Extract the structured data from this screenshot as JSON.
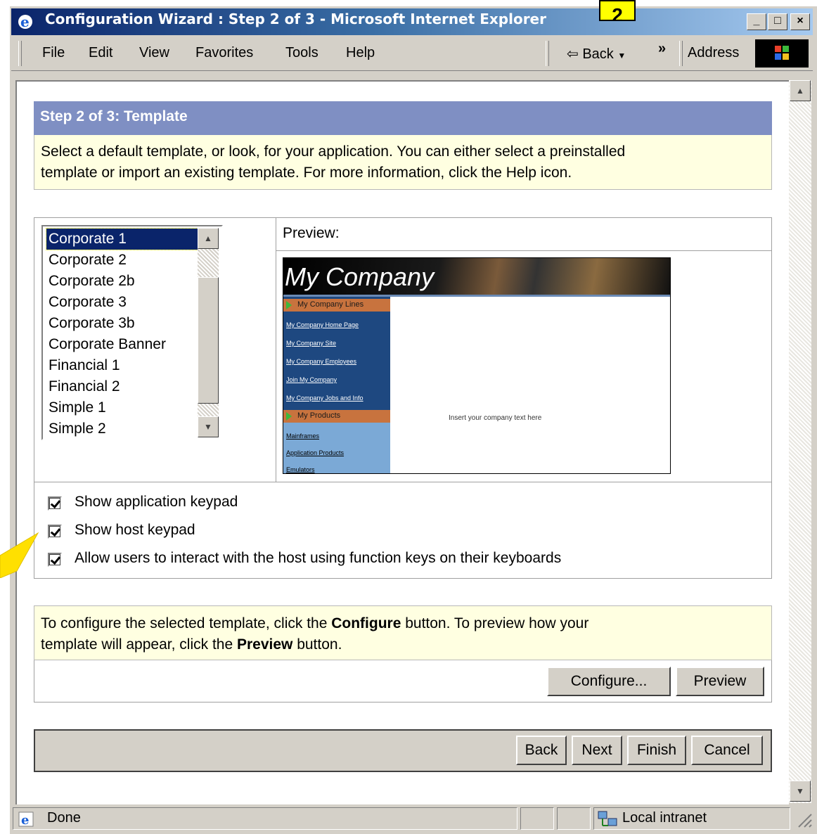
{
  "window": {
    "title": "Configuration Wizard : Step 2 of 3 - Microsoft Internet Explorer",
    "callout_number": "2"
  },
  "menubar": {
    "items": [
      "File",
      "Edit",
      "View",
      "Favorites",
      "Tools",
      "Help"
    ],
    "back_label": "Back",
    "overflow_label": "»",
    "address_label": "Address"
  },
  "wizard": {
    "step_title": "Step 2 of 3: Template",
    "intro_line1": "Select a default template, or look, for your application. You can either select a preinstalled",
    "intro_line2": "template or import an existing template. For more information, click the Help icon.",
    "templates": [
      "Corporate 1",
      "Corporate 2",
      "Corporate 2b",
      "Corporate 3",
      "Corporate 3b",
      "Corporate Banner",
      "Financial 1",
      "Financial 2",
      "Simple 1",
      "Simple 2"
    ],
    "selected_template": "Corporate 1",
    "preview_label": "Preview:",
    "preview": {
      "company": "My Company",
      "nav_header_1": "My Company Lines",
      "nav_links_1": [
        "My Company Home Page",
        "My Company Site",
        "My Company Employees",
        "Join My Company",
        "My Company Jobs and Info"
      ],
      "nav_header_2": "My Products",
      "nav_links_2": [
        "Mainframes",
        "Application Products",
        "Emulators"
      ],
      "body_text": "Insert your company text here"
    },
    "options": [
      {
        "label": "Show application keypad",
        "checked": true
      },
      {
        "label": "Show host keypad",
        "checked": true
      },
      {
        "label": "Allow users to interact with the host using function keys on their keyboards",
        "checked": true
      }
    ],
    "configure_note": {
      "part1": "To configure the selected template, click the ",
      "bold1": "Configure",
      "part2": " button. To preview how your",
      "part3": "template will appear, click the ",
      "bold2": "Preview",
      "part4": " button."
    },
    "configure_button": "Configure...",
    "preview_button": "Preview",
    "nav_buttons": {
      "back": "Back",
      "next": "Next",
      "finish": "Finish",
      "cancel": "Cancel"
    }
  },
  "statusbar": {
    "status": "Done",
    "zone": "Local intranet"
  },
  "colors": {
    "title_gradient_start": "#0a246a",
    "step_header": "#7f8fc3",
    "note_background": "#ffffe1",
    "selection": "#0a246a",
    "callout": "#ffff00"
  }
}
